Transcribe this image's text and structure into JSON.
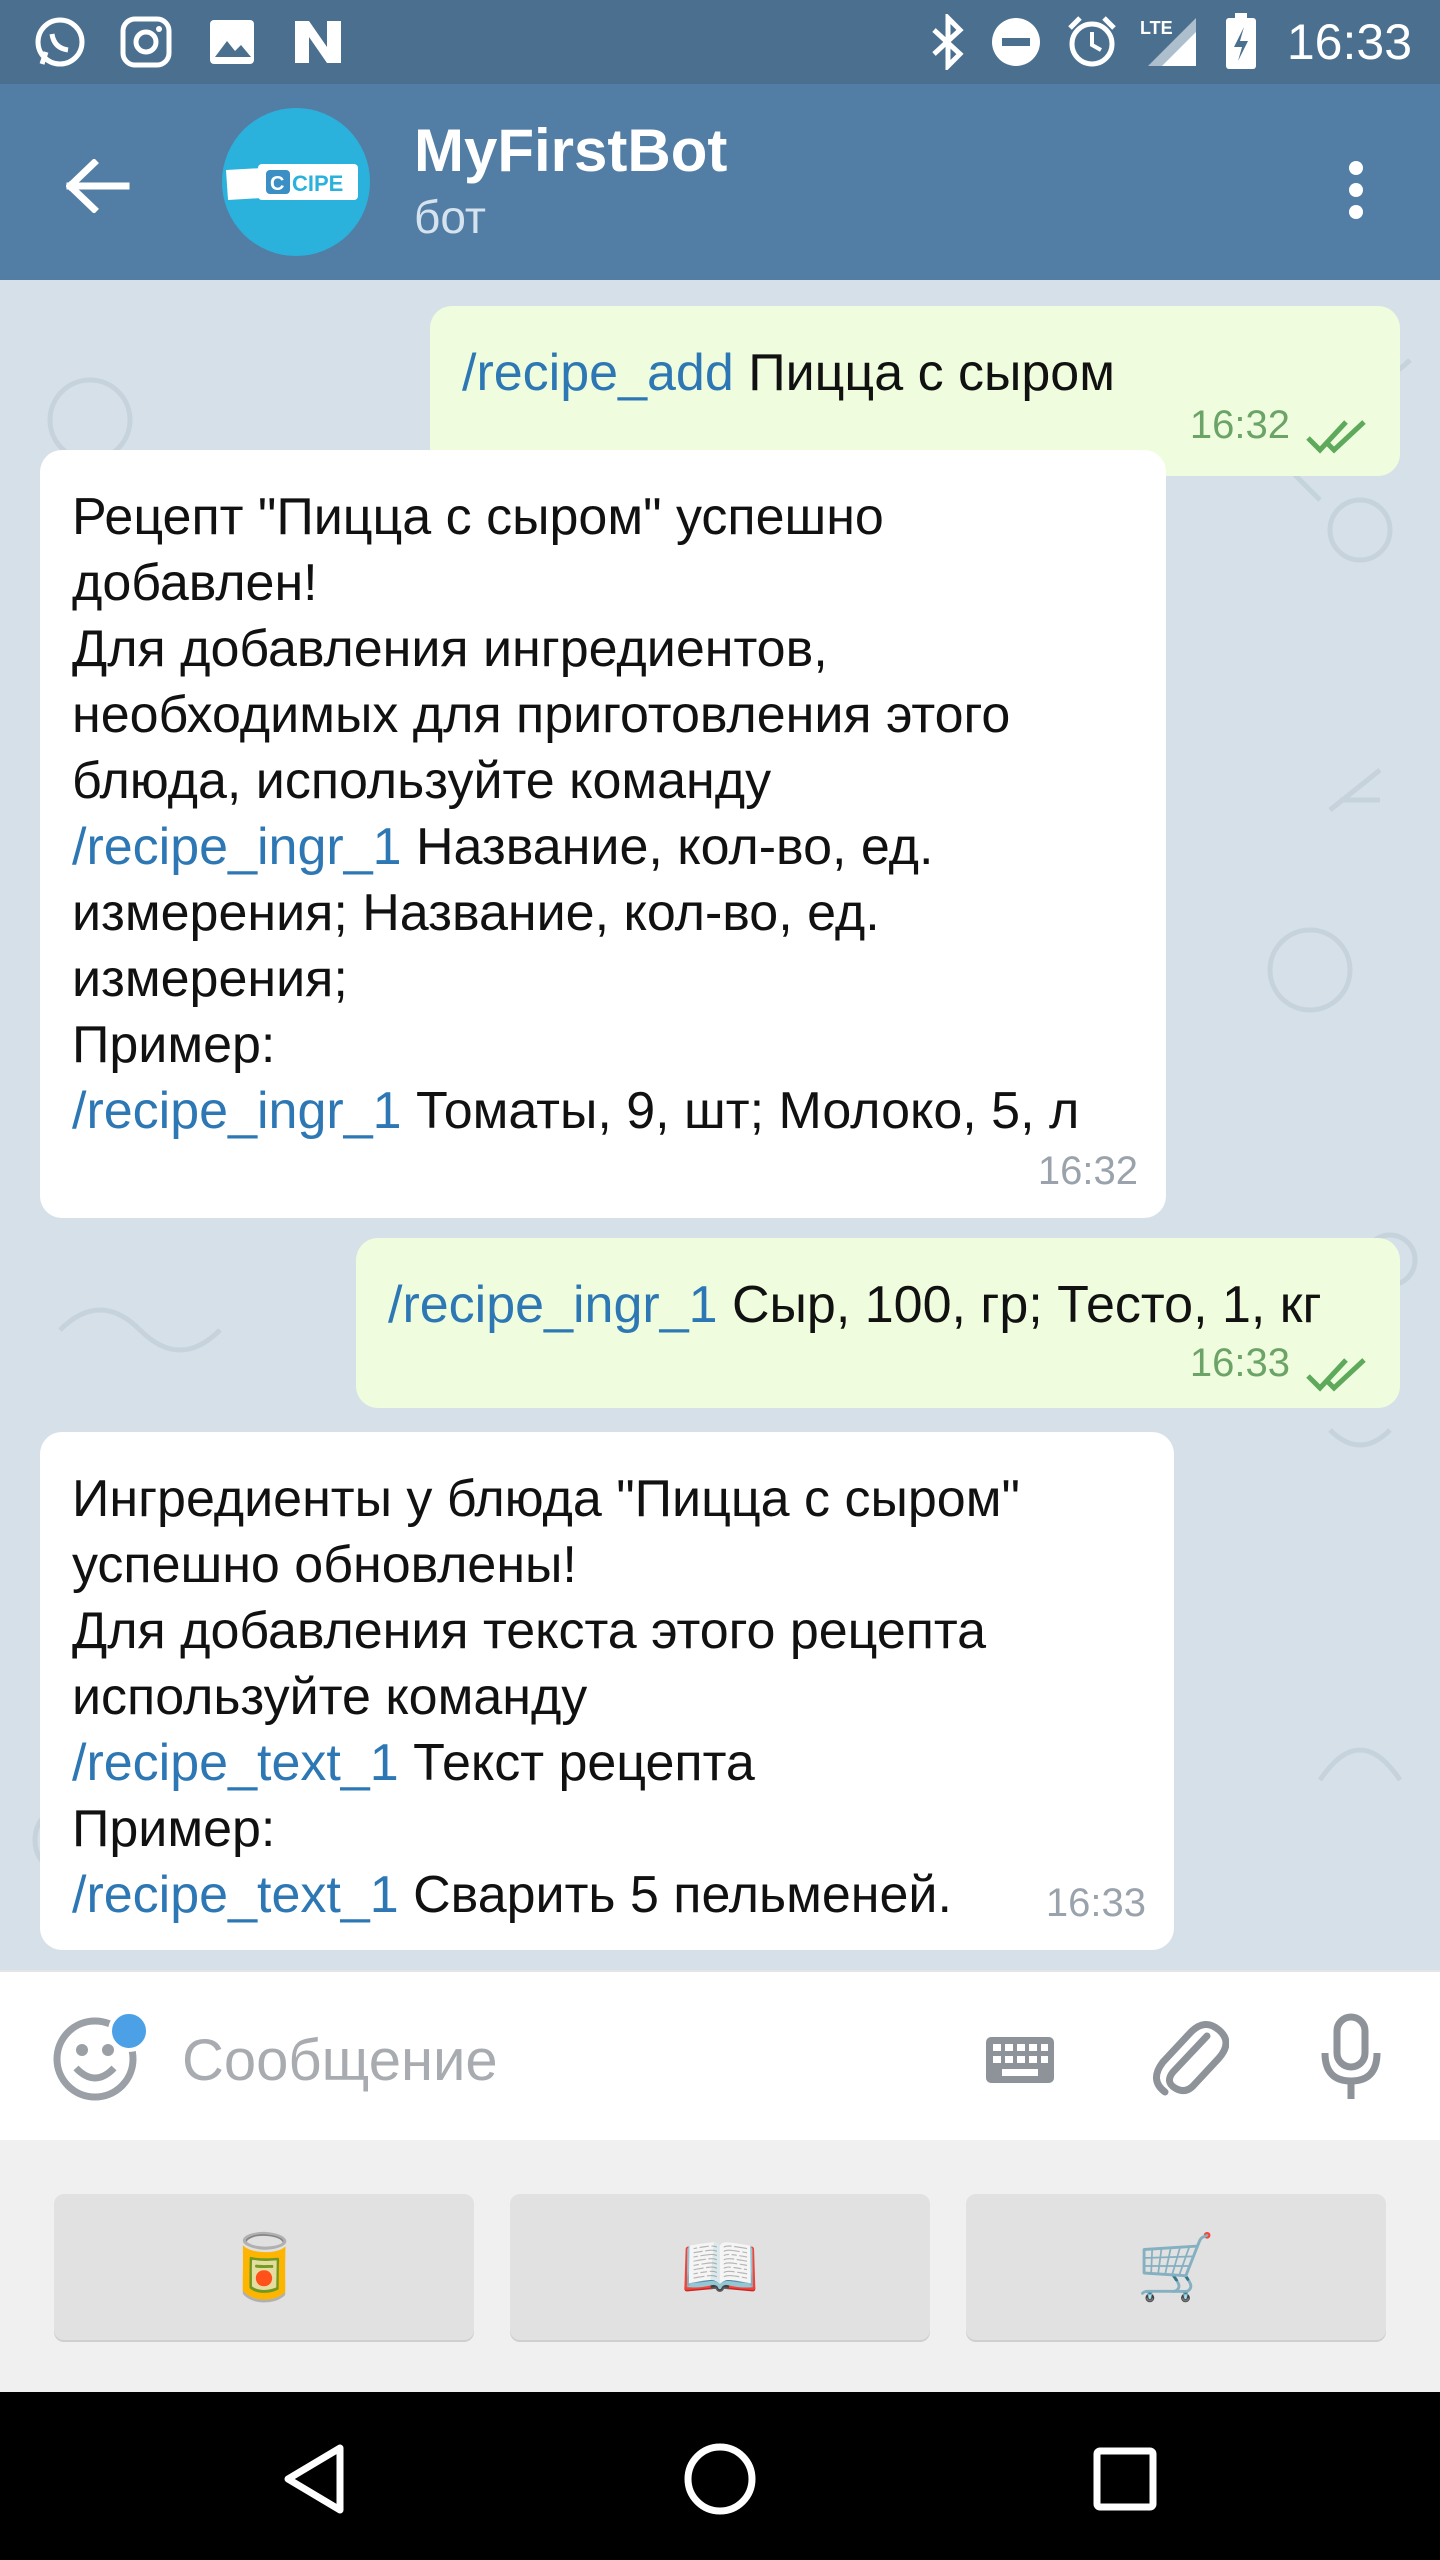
{
  "status_bar": {
    "time": "16:33",
    "left_icons": [
      "whatsapp-icon",
      "instagram-icon",
      "gallery-icon",
      "news-icon"
    ],
    "right_icons": [
      "bluetooth-icon",
      "do-not-disturb-icon",
      "alarm-icon",
      "lte-signal-icon",
      "battery-icon"
    ],
    "network_label": "LTE"
  },
  "header": {
    "title": "MyFirstBot",
    "subtitle": "бот",
    "avatar_text": "CIPE",
    "colors": {
      "toolbar": "#527ea5",
      "status_bar": "#4a6f8f",
      "avatar": "#2ab2dd"
    }
  },
  "messages": [
    {
      "direction": "outgoing",
      "command": "/recipe_add",
      "text": " Пицца с сыром",
      "time": "16:32",
      "read": true
    },
    {
      "direction": "incoming",
      "lines": [
        {
          "text": "Рецепт \"Пицца с сыром\" успешно"
        },
        {
          "text": "добавлен!"
        },
        {
          "text": "Для добавления ингредиентов,"
        },
        {
          "text": "необходимых для приготовления этого"
        },
        {
          "text": "блюда, используйте команду"
        },
        {
          "command": "/recipe_ingr_1",
          "text": " Название, кол-во, ед."
        },
        {
          "text": "измерения; Название, кол-во, ед."
        },
        {
          "text": "измерения;"
        },
        {
          "text": "Пример:"
        },
        {
          "command": "/recipe_ingr_1",
          "text": " Томаты, 9, шт; Молоко, 5, л"
        }
      ],
      "time": "16:32"
    },
    {
      "direction": "outgoing",
      "command": "/recipe_ingr_1",
      "text": " Сыр, 100, гр; Тесто, 1, кг",
      "time": "16:33",
      "read": true
    },
    {
      "direction": "incoming",
      "lines": [
        {
          "text": "Ингредиенты у блюда \"Пицца с сыром\""
        },
        {
          "text": "успешно обновлены!"
        },
        {
          "text": "Для добавления текста этого рецепта"
        },
        {
          "text": "используйте команду"
        },
        {
          "command": "/recipe_text_1",
          "text": " Текст рецепта"
        },
        {
          "text": "Пример:"
        },
        {
          "command": "/recipe_text_1",
          "text": " Сварить 5 пельменей."
        }
      ],
      "time": "16:33"
    }
  ],
  "input": {
    "placeholder": "Сообщение",
    "value": ""
  },
  "bot_keyboard": [
    {
      "emoji": "🥫",
      "icon": "canned-food-icon"
    },
    {
      "emoji": "📖",
      "icon": "open-book-icon"
    },
    {
      "emoji": "🛒",
      "icon": "shopping-cart-icon"
    }
  ],
  "nav_bar": [
    "back-triangle-icon",
    "home-circle-icon",
    "recents-square-icon"
  ],
  "colors": {
    "outgoing_bubble": "#effdde",
    "incoming_bubble": "#ffffff",
    "command_link": "#2d78b4",
    "outgoing_time": "#6ca367",
    "incoming_time": "#9aa3ab"
  }
}
